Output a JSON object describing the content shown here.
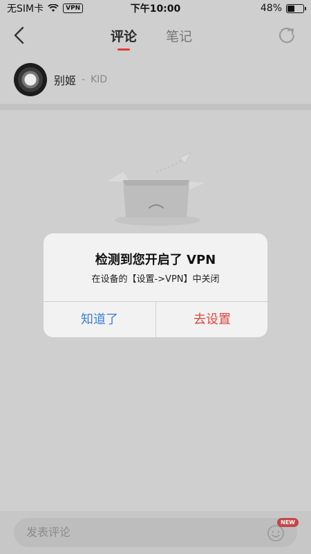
{
  "status_bar": {
    "carrier": "无SIM卡",
    "vpn_label": "VPN",
    "time": "下午10:00",
    "battery_percent": "48%",
    "battery_level": 0.48
  },
  "nav": {
    "tabs": [
      {
        "label": "评论",
        "active": true
      },
      {
        "label": "笔记",
        "active": false
      }
    ]
  },
  "author": {
    "name": "别姬",
    "separator": "-",
    "artist": "KID"
  },
  "dialog": {
    "title": "检测到您开启了 VPN",
    "message": "在设备的【设置->VPN】中关闭",
    "ok_label": "知道了",
    "settings_label": "去设置",
    "ok_color": "#3d7fd6",
    "settings_color": "#e0463e"
  },
  "bottom": {
    "input_placeholder": "发表评论",
    "new_badge": "NEW"
  },
  "colors": {
    "accent": "#e23a3a"
  }
}
